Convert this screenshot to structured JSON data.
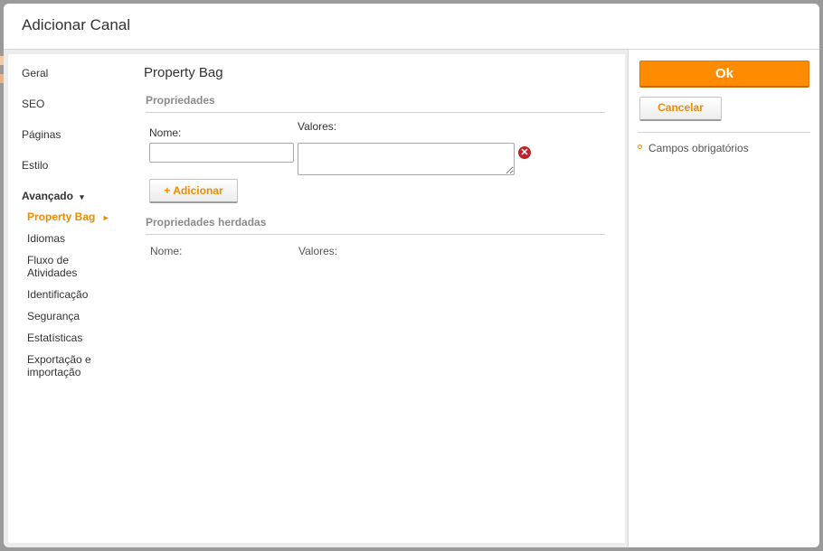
{
  "dialog": {
    "title": "Adicionar Canal"
  },
  "nav": {
    "items": [
      {
        "label": "Geral"
      },
      {
        "label": "SEO"
      },
      {
        "label": "Páginas"
      },
      {
        "label": "Estilo"
      }
    ],
    "group": {
      "label": "Avançado",
      "icon": "caret-down-icon",
      "arrow": "▾"
    },
    "subitems": [
      {
        "label": "Property Bag",
        "active": true,
        "arrow": "►"
      },
      {
        "label": "Idiomas"
      },
      {
        "label": "Fluxo de Atividades"
      },
      {
        "label": "Identificação"
      },
      {
        "label": "Segurança"
      },
      {
        "label": "Estatísticas"
      },
      {
        "label": "Exportação e importação"
      }
    ]
  },
  "form": {
    "heading": "Property Bag",
    "properties_section": "Propriedades",
    "name_label": "Nome:",
    "values_label": "Valores:",
    "name_value": "",
    "values_value": "",
    "remove_glyph": "✕",
    "add_button": "+ Adicionar",
    "inherited_section": "Propriedades herdadas",
    "inherited_name_label": "Nome:",
    "inherited_values_label": "Valores:"
  },
  "actions": {
    "ok_label": "Ok",
    "cancel_label": "Cancelar",
    "required_note": "Campos obrigatórios"
  },
  "colors": {
    "accent": "#ff8c00",
    "accent_text": "#f08a00",
    "danger": "#b8262b"
  }
}
